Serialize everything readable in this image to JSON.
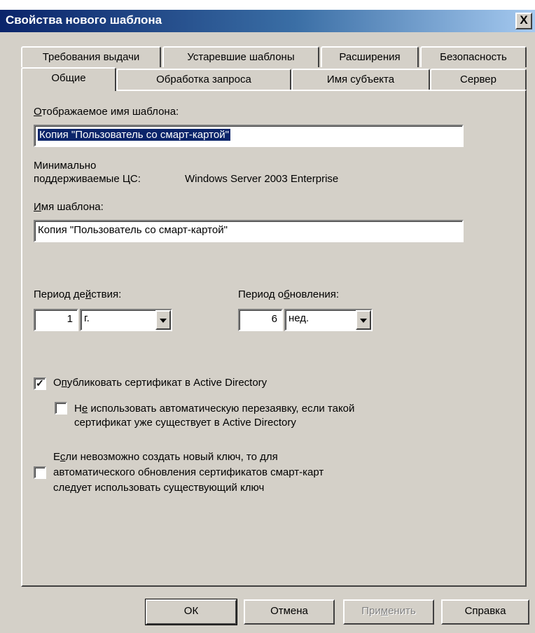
{
  "window": {
    "title": "Свойства нового шаблона",
    "close_glyph": "X"
  },
  "tabs_row1": [
    {
      "label": "Требования выдачи"
    },
    {
      "label": "Устаревшие шаблоны"
    },
    {
      "label": "Расширения"
    },
    {
      "label": "Безопасность"
    }
  ],
  "tabs_row2": [
    {
      "label": "Общие",
      "active": true
    },
    {
      "label": "Обработка запроса"
    },
    {
      "label": "Имя субъекта"
    },
    {
      "label": "Сервер"
    }
  ],
  "general": {
    "display_name_label_pre": "",
    "display_name_label_mn": "О",
    "display_name_label_post": "тображаемое имя шаблона:",
    "display_name_value": "Копия \"Пользователь со смарт-картой\"",
    "min_ca_label_line1": "Минимально",
    "min_ca_label_line2": "поддерживаемые ЦС:",
    "min_ca_value": "Windows Server 2003 Enterprise",
    "template_name_label_mn": "И",
    "template_name_label_post": "мя шаблона:",
    "template_name_value": "Копия \"Пользователь со смарт-картой\"",
    "validity_label_pre": "Период де",
    "validity_label_mn": "й",
    "validity_label_post": "ствия:",
    "validity_number": "1",
    "validity_unit": "г.",
    "renewal_label_pre": "Период о",
    "renewal_label_mn": "б",
    "renewal_label_post": "новления:",
    "renewal_number": "6",
    "renewal_unit": "нед.",
    "publish_ad_checked": true,
    "publish_ad_pre": "О",
    "publish_ad_mn": "п",
    "publish_ad_post": "убликовать сертификат в Active Directory",
    "no_reenroll_checked": false,
    "no_reenroll_pre": "Н",
    "no_reenroll_mn": "е",
    "no_reenroll_post": " использовать автоматическую перезаявку, если такой",
    "no_reenroll_line2": "сертификат уже существует в Active Directory",
    "existing_key_checked": false,
    "existing_key_pre": "Е",
    "existing_key_mn": "с",
    "existing_key_post": "ли невозможно создать новый ключ, то для",
    "existing_key_line2": "автоматического обновления сертификатов смарт-карт",
    "existing_key_line3": "следует использовать существующий ключ"
  },
  "buttons": {
    "ok": "ОК",
    "cancel": "Отмена",
    "apply_pre": "При",
    "apply_mn": "м",
    "apply_post": "енить",
    "help": "Справка"
  }
}
